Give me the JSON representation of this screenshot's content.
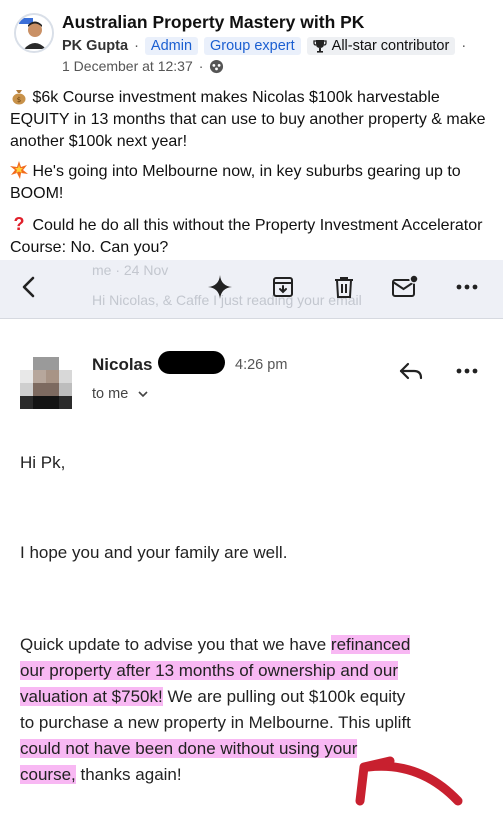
{
  "post": {
    "group_name": "Australian Property Mastery with PK",
    "author": "PK Gupta",
    "badges": [
      "Admin",
      "Group expert"
    ],
    "contributor_badge": "All-star contributor",
    "date": "1 December at 12:37",
    "lines": [
      "$6k Course investment makes Nicolas $100k harvestable EQUITY in 13 months that can use to buy another property & make another $100k next year!",
      "He's going into Melbourne now, in key suburbs gearing up to BOOM!",
      "Could he do all this without the Property Investment Accelerator Course: No. Can you?"
    ],
    "line_icons": [
      "money-bag-icon",
      "collision-icon",
      "question-mark-icon"
    ]
  },
  "toolbar": {
    "ghost_line_1": "me · 24 Nov",
    "ghost_line_2": "Hi Nicolas, & Caffe I just reading your email"
  },
  "email": {
    "sender": "Nicolas",
    "time": "4:26 pm",
    "to": "to me",
    "greeting": "Hi Pk,",
    "para1": "I hope you and your family are well.",
    "para2_lines": [
      "Quick update to advise you that we have refinanced",
      "our property after 13 months of ownership and our",
      "valuation at $750k! We are pulling out $100k equity",
      "to purchase a new property in Melbourne. This uplift",
      "could not have been done without using your",
      "course, thanks again!"
    ]
  },
  "colors": {
    "highlight": "#f8b8f3",
    "arrow": "#c8202f",
    "badge_blue": "#1b5fd1",
    "toolbar_bg": "#eef0f6"
  }
}
